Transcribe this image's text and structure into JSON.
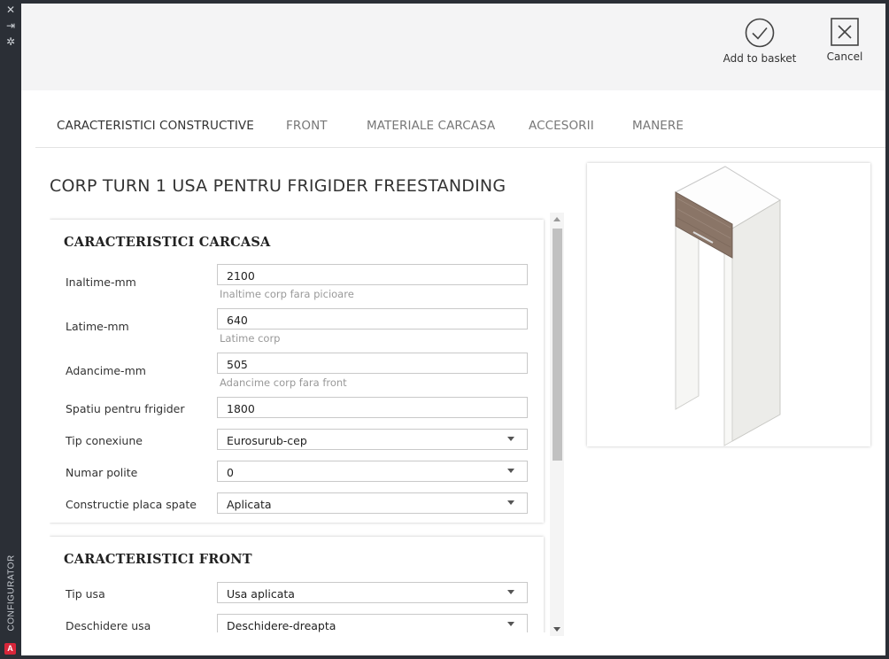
{
  "rail": {
    "vertical_label": "CONFIGURATOR",
    "logo_letter": "A",
    "close_glyph": "✕",
    "pin_glyph": "⇥",
    "settings_glyph": "✲"
  },
  "header": {
    "add_to_basket_label": "Add to basket",
    "cancel_label": "Cancel"
  },
  "tabs": [
    {
      "label": "CARACTERISTICI CONSTRUCTIVE",
      "active": true
    },
    {
      "label": "FRONT",
      "active": false
    },
    {
      "label": "MATERIALE CARCASA",
      "active": false
    },
    {
      "label": "ACCESORII",
      "active": false
    },
    {
      "label": "MANERE",
      "active": false
    }
  ],
  "page_title": "CORP TURN 1 USA PENTRU FRIGIDER FREESTANDING",
  "section_carcasa": {
    "title": "CARACTERISTICI CARCASA",
    "inaltime": {
      "label": "Inaltime-mm",
      "value": "2100",
      "hint": "Inaltime corp fara picioare"
    },
    "latime": {
      "label": "Latime-mm",
      "value": "640",
      "hint": "Latime corp"
    },
    "adancime": {
      "label": "Adancime-mm",
      "value": "505",
      "hint": "Adancime corp fara front"
    },
    "spatiu": {
      "label": "Spatiu pentru frigider",
      "value": "1800"
    },
    "tip_conexiune": {
      "label": "Tip conexiune",
      "value": "Eurosurub-cep"
    },
    "numar_polite": {
      "label": "Numar polite",
      "value": "0"
    },
    "constructie_placa": {
      "label": "Constructie placa spate",
      "value": "Aplicata"
    }
  },
  "section_front": {
    "title": "CARACTERISTICI FRONT",
    "tip_usa": {
      "label": "Tip usa",
      "value": "Usa aplicata"
    },
    "deschidere_usa": {
      "label": "Deschidere usa",
      "value": "Deschidere-dreapta"
    }
  },
  "colors": {
    "rail": "#2b2f36",
    "header_bg": "#f4f4f5",
    "panel_white": "#ffffff",
    "wood": "#8a7567",
    "accent_logo": "#d8263a"
  },
  "icons": {
    "add_to_basket": "check-circle-icon",
    "cancel": "close-box-icon"
  }
}
